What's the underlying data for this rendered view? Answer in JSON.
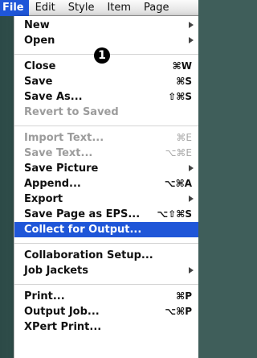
{
  "menubar": {
    "menus": [
      "File",
      "Edit",
      "Style",
      "Item",
      "Page"
    ]
  },
  "badge": {
    "label": "1"
  },
  "file_menu": {
    "items": [
      {
        "label": "New",
        "shortcut": "",
        "submenu": true,
        "disabled": false
      },
      {
        "label": "Open",
        "shortcut": "",
        "submenu": true,
        "disabled": false
      },
      {
        "label": "Close",
        "shortcut": "⌘W",
        "submenu": false,
        "disabled": false
      },
      {
        "label": "Save",
        "shortcut": "⌘S",
        "submenu": false,
        "disabled": false
      },
      {
        "label": "Save As...",
        "shortcut": "⇧⌘S",
        "submenu": false,
        "disabled": false
      },
      {
        "label": "Revert to Saved",
        "shortcut": "",
        "submenu": false,
        "disabled": true
      },
      {
        "label": "Import Text...",
        "shortcut": "⌘E",
        "submenu": false,
        "disabled": true
      },
      {
        "label": "Save Text...",
        "shortcut": "⌥⌘E",
        "submenu": false,
        "disabled": true
      },
      {
        "label": "Save Picture",
        "shortcut": "",
        "submenu": true,
        "disabled": false
      },
      {
        "label": "Append...",
        "shortcut": "⌥⌘A",
        "submenu": false,
        "disabled": false
      },
      {
        "label": "Export",
        "shortcut": "",
        "submenu": true,
        "disabled": false
      },
      {
        "label": "Save Page as EPS...",
        "shortcut": "⌥⇧⌘S",
        "submenu": false,
        "disabled": false
      },
      {
        "label": "Collect for Output...",
        "shortcut": "",
        "submenu": false,
        "disabled": false,
        "highlighted": true
      },
      {
        "label": "Collaboration Setup...",
        "shortcut": "",
        "submenu": false,
        "disabled": false
      },
      {
        "label": "Job Jackets",
        "shortcut": "",
        "submenu": true,
        "disabled": false
      },
      {
        "label": "Print...",
        "shortcut": "⌘P",
        "submenu": false,
        "disabled": false
      },
      {
        "label": "Output Job...",
        "shortcut": "⌥⌘P",
        "submenu": false,
        "disabled": false
      },
      {
        "label": "XPert Print...",
        "shortcut": "",
        "submenu": false,
        "disabled": false
      }
    ]
  },
  "colors": {
    "highlight": "#1f56d8",
    "disabled_text": "#9c9c9c"
  }
}
